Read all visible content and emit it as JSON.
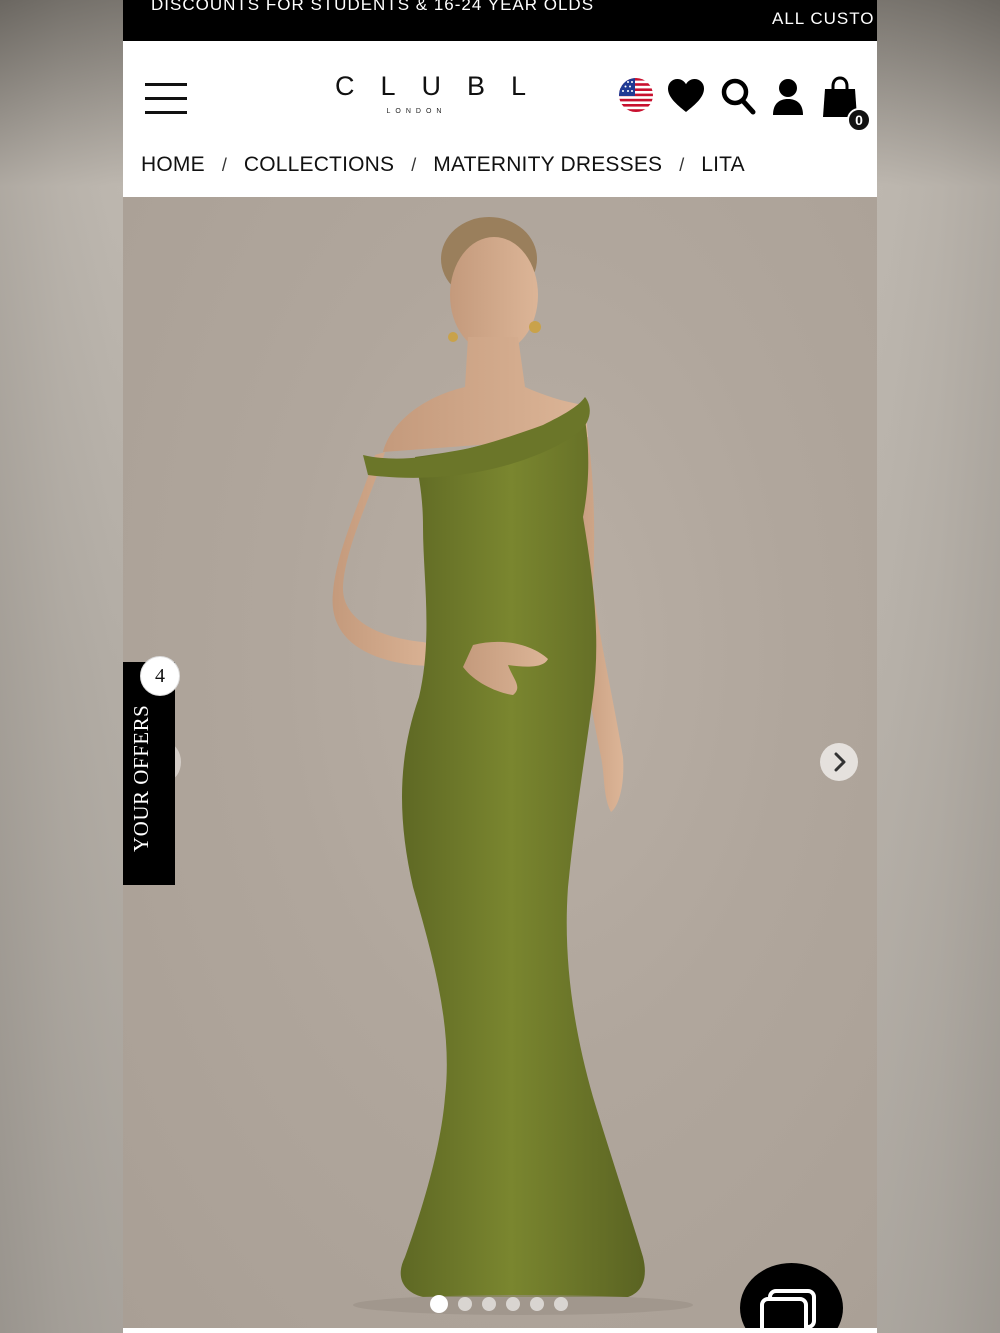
{
  "promo": {
    "left_text": "DISCOUNTS FOR STUDENTS & 16-24 YEAR OLDS",
    "right_text": "ALL CUSTO"
  },
  "header": {
    "logo_main": "CLUBL",
    "logo_sub": "LONDON",
    "cart_count": "0",
    "icons": [
      "menu-icon",
      "us-flag-icon",
      "heart-icon",
      "search-icon",
      "account-icon",
      "bag-icon"
    ]
  },
  "breadcrumb": {
    "items": [
      "HOME",
      "COLLECTIONS",
      "MATERNITY DRESSES",
      "LITA"
    ],
    "separator": "/"
  },
  "gallery": {
    "slide_count": 6,
    "active_slide": 1,
    "dress_color": "#6f7a2c"
  },
  "offers": {
    "label": "YOUR OFFERS",
    "count": "4"
  }
}
